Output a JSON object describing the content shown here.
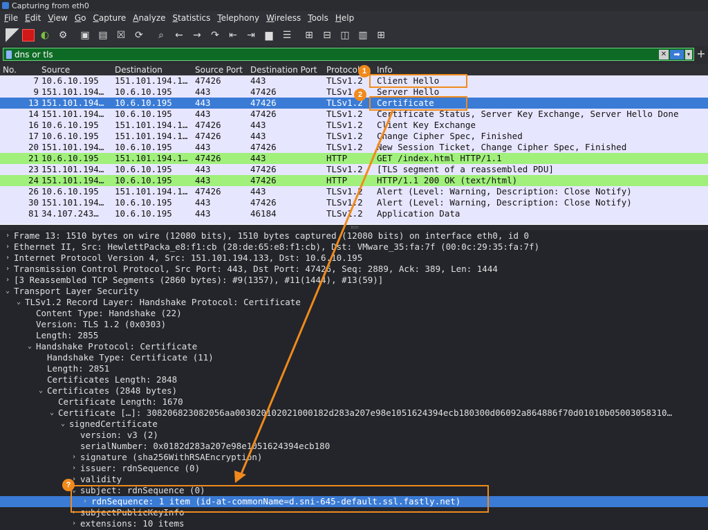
{
  "window": {
    "title": "Capturing from eth0"
  },
  "menu": [
    "File",
    "Edit",
    "View",
    "Go",
    "Capture",
    "Analyze",
    "Statistics",
    "Telephony",
    "Wireless",
    "Tools",
    "Help"
  ],
  "menu_underline": [
    "F",
    "E",
    "V",
    "G",
    "C",
    "A",
    "S",
    "T",
    "W",
    "T",
    "H"
  ],
  "toolbar_icons": [
    "shark-fin-start-icon",
    "stop-capture-icon",
    "restart-capture-icon",
    "capture-options-icon",
    "open-file-icon",
    "save-file-icon",
    "close-file-icon",
    "reload-icon",
    "find-icon",
    "go-back-icon",
    "go-forward-icon",
    "go-to-packet-icon",
    "first-packet-icon",
    "last-packet-icon",
    "auto-scroll-icon",
    "colorize-icon",
    "zoom-in-icon",
    "zoom-out-icon",
    "normal-size-icon",
    "resize-columns-icon",
    "layout-icon"
  ],
  "filter": {
    "value": "dns or tls"
  },
  "columns": [
    "No.",
    "Source",
    "Destination",
    "Source Port",
    "Destination Port",
    "Protocol",
    "Info"
  ],
  "packets": [
    {
      "no": "7",
      "src": "10.6.10.195",
      "dst": "151.101.194.1…",
      "sport": "47426",
      "dport": "443",
      "proto": "TLSv1.2",
      "info": "Client Hello",
      "style": "tls"
    },
    {
      "no": "9",
      "src": "151.101.194…",
      "dst": "10.6.10.195",
      "sport": "443",
      "dport": "47426",
      "proto": "TLSv1.2",
      "info": "Server Hello",
      "style": "tls"
    },
    {
      "no": "13",
      "src": "151.101.194…",
      "dst": "10.6.10.195",
      "sport": "443",
      "dport": "47426",
      "proto": "TLSv1.2",
      "info": "Certificate",
      "style": "sel"
    },
    {
      "no": "14",
      "src": "151.101.194…",
      "dst": "10.6.10.195",
      "sport": "443",
      "dport": "47426",
      "proto": "TLSv1.2",
      "info": "Certificate Status, Server Key Exchange, Server Hello Done",
      "style": "tls"
    },
    {
      "no": "16",
      "src": "10.6.10.195",
      "dst": "151.101.194.1…",
      "sport": "47426",
      "dport": "443",
      "proto": "TLSv1.2",
      "info": "Client Key Exchange",
      "style": "tls"
    },
    {
      "no": "17",
      "src": "10.6.10.195",
      "dst": "151.101.194.1…",
      "sport": "47426",
      "dport": "443",
      "proto": "TLSv1.2",
      "info": "Change Cipher Spec, Finished",
      "style": "tls"
    },
    {
      "no": "20",
      "src": "151.101.194…",
      "dst": "10.6.10.195",
      "sport": "443",
      "dport": "47426",
      "proto": "TLSv1.2",
      "info": "New Session Ticket, Change Cipher Spec, Finished",
      "style": "tls"
    },
    {
      "no": "21",
      "src": "10.6.10.195",
      "dst": "151.101.194.1…",
      "sport": "47426",
      "dport": "443",
      "proto": "HTTP",
      "info": "GET /index.html HTTP/1.1",
      "style": "http"
    },
    {
      "no": "23",
      "src": "151.101.194…",
      "dst": "10.6.10.195",
      "sport": "443",
      "dport": "47426",
      "proto": "TLSv1.2",
      "info": "[TLS segment of a reassembled PDU]",
      "style": "tls"
    },
    {
      "no": "24",
      "src": "151.101.194…",
      "dst": "10.6.10.195",
      "sport": "443",
      "dport": "47426",
      "proto": "HTTP",
      "info": "HTTP/1.1 200 OK  (text/html)",
      "style": "http"
    },
    {
      "no": "26",
      "src": "10.6.10.195",
      "dst": "151.101.194.1…",
      "sport": "47426",
      "dport": "443",
      "proto": "TLSv1.2",
      "info": "Alert (Level: Warning, Description: Close Notify)",
      "style": "tls"
    },
    {
      "no": "30",
      "src": "151.101.194…",
      "dst": "10.6.10.195",
      "sport": "443",
      "dport": "47426",
      "proto": "TLSv1.2",
      "info": "Alert (Level: Warning, Description: Close Notify)",
      "style": "tls"
    },
    {
      "no": "81",
      "src": "34.107.243…",
      "dst": "10.6.10.195",
      "sport": "443",
      "dport": "46184",
      "proto": "TLSv1.2",
      "info": "Application Data",
      "style": "tls"
    }
  ],
  "details": [
    {
      "level": 0,
      "tw": "›",
      "text": "Frame 13: 1510 bytes on wire (12080 bits), 1510 bytes captured (12080 bits) on interface eth0, id 0"
    },
    {
      "level": 0,
      "tw": "›",
      "text": "Ethernet II, Src: HewlettPacka_e8:f1:cb (28:de:65:e8:f1:cb), Dst: VMware_35:fa:7f (00:0c:29:35:fa:7f)"
    },
    {
      "level": 0,
      "tw": "›",
      "text": "Internet Protocol Version 4, Src: 151.101.194.133, Dst: 10.6.10.195"
    },
    {
      "level": 0,
      "tw": "›",
      "text": "Transmission Control Protocol, Src Port: 443, Dst Port: 47426, Seq: 2889, Ack: 389, Len: 1444"
    },
    {
      "level": 0,
      "tw": "›",
      "text": "[3 Reassembled TCP Segments (2860 bytes): #9(1357), #11(1444), #13(59)]"
    },
    {
      "level": 0,
      "tw": "⌄",
      "text": "Transport Layer Security"
    },
    {
      "level": 1,
      "tw": "⌄",
      "text": "TLSv1.2 Record Layer: Handshake Protocol: Certificate"
    },
    {
      "level": 2,
      "tw": "",
      "text": "Content Type: Handshake (22)"
    },
    {
      "level": 2,
      "tw": "",
      "text": "Version: TLS 1.2 (0x0303)"
    },
    {
      "level": 2,
      "tw": "",
      "text": "Length: 2855"
    },
    {
      "level": 2,
      "tw": "⌄",
      "text": "Handshake Protocol: Certificate"
    },
    {
      "level": 3,
      "tw": "",
      "text": "Handshake Type: Certificate (11)"
    },
    {
      "level": 3,
      "tw": "",
      "text": "Length: 2851"
    },
    {
      "level": 3,
      "tw": "",
      "text": "Certificates Length: 2848"
    },
    {
      "level": 3,
      "tw": "⌄",
      "text": "Certificates (2848 bytes)"
    },
    {
      "level": 4,
      "tw": "",
      "text": "Certificate Length: 1670"
    },
    {
      "level": 4,
      "tw": "⌄",
      "text": "Certificate […]: 308206823082056aa003020102021000182d283a207e98e1051624394ecb180300d06092a864886f70d01010b05003058310…"
    },
    {
      "level": 5,
      "tw": "⌄",
      "text": "signedCertificate"
    },
    {
      "level": 6,
      "tw": "",
      "text": "version: v3 (2)"
    },
    {
      "level": 6,
      "tw": "",
      "text": "serialNumber: 0x0182d283a207e98e1051624394ecb180"
    },
    {
      "level": 6,
      "tw": "›",
      "text": "signature (sha256WithRSAEncryption)"
    },
    {
      "level": 6,
      "tw": "›",
      "text": "issuer: rdnSequence (0)"
    },
    {
      "level": 6,
      "tw": "›",
      "text": "validity"
    },
    {
      "level": 6,
      "tw": "⌄",
      "text": "subject: rdnSequence (0)"
    },
    {
      "level": 7,
      "tw": "›",
      "text": "rdnSequence: 1 item (id-at-commonName=d.sni-645-default.ssl.fastly.net)",
      "selected": true
    },
    {
      "level": 6,
      "tw": "›",
      "text": "subjectPublicKeyInfo"
    },
    {
      "level": 6,
      "tw": "›",
      "text": "extensions: 10 items"
    }
  ],
  "annotations": {
    "badge1": "1",
    "badge2": "2",
    "badge3": "?"
  },
  "colors": {
    "accent": "#f08a1c",
    "selection": "#3a7bd5",
    "tls_row": "#e7e6ff",
    "http_row": "#a0f07b",
    "filter_ok": "#0e6b25"
  }
}
